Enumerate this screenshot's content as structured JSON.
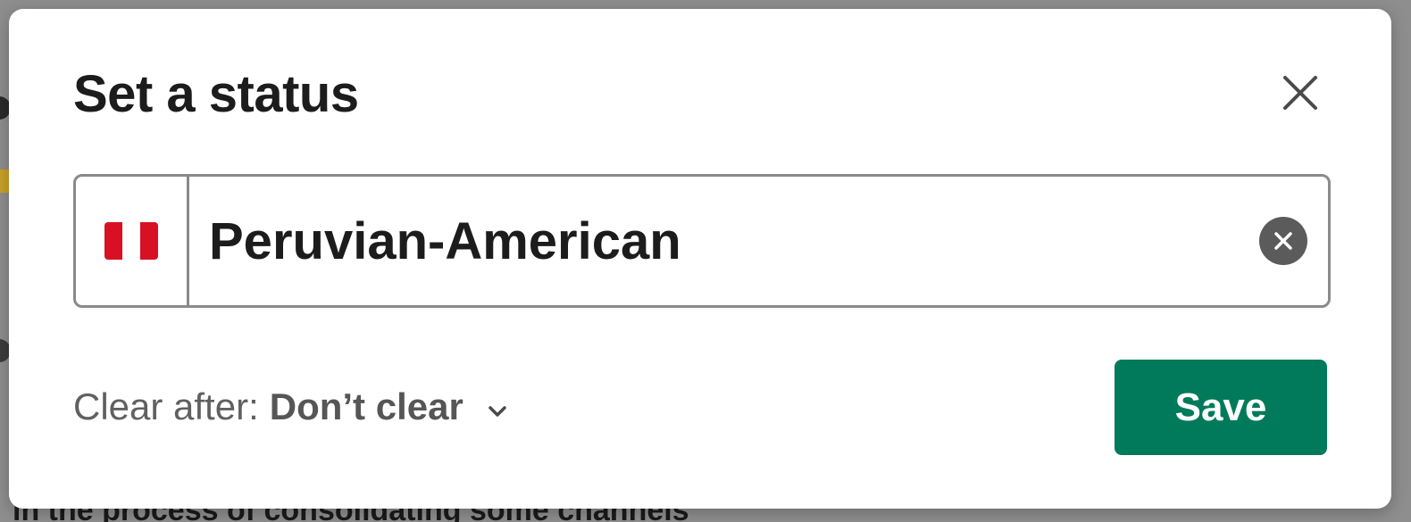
{
  "background": {
    "partial_text": "in the process of consolidating some channels"
  },
  "modal": {
    "title": "Set a status",
    "close_icon": "close-icon",
    "status": {
      "emoji": "🇵🇪",
      "emoji_name": "flag-peru",
      "value": "Peruvian-American",
      "clear_icon": "clear-circle-icon"
    },
    "clear_after": {
      "label": "Clear after:",
      "value": "Don’t clear",
      "icon": "chevron-down-icon"
    },
    "save_label": "Save"
  },
  "colors": {
    "save_button": "#007a5a",
    "title_text": "#1d1c1d",
    "input_border": "#8a8a8a",
    "clear_circle": "#5b5b5b",
    "overlay": "#8e8e8e"
  }
}
